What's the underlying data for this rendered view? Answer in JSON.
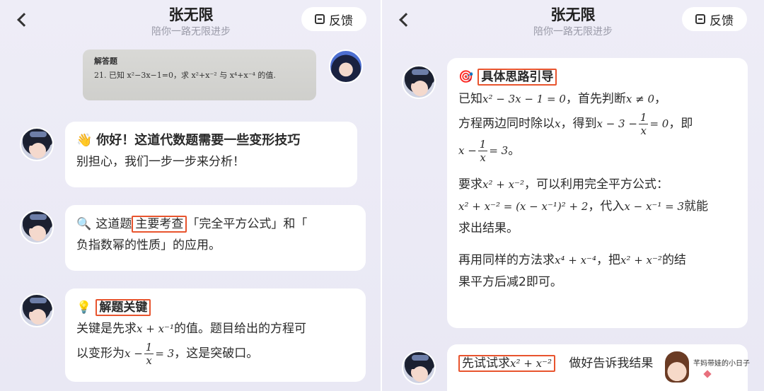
{
  "header": {
    "title": "张无限",
    "subtitle": "陪你一路无限进步",
    "feedback_label": "反馈"
  },
  "left": {
    "photo": {
      "heading": "解答题",
      "question": "21. 已知 x²−3x−1=0，求 x²+x⁻² 与 x⁴+x⁻⁴ 的值."
    },
    "msg1": {
      "emoji": "👋",
      "line1": "你好！这道代数题需要一些变形技巧",
      "line2": "别担心，我们一步一步来分析！"
    },
    "msg2": {
      "emoji": "🔍",
      "pre": "这道题",
      "highlight": "主要考查",
      "post": "「完全平方公式」和「",
      "line2": "负指数幂的性质」的应用。"
    },
    "msg3": {
      "emoji": "💡",
      "heading": "解题关键",
      "l2_pre": "关键是先求",
      "l2_math": "x + x⁻¹",
      "l2_post": "的值。题目给出的方程可",
      "l3_pre": "以变形为",
      "l3_math_a": "x −",
      "frac_num": "1",
      "frac_den": "x",
      "l3_math_b": "= 3",
      "l3_post": "，这是突破口。"
    }
  },
  "right": {
    "msg1": {
      "emoji": "🎯",
      "heading": "具体思路引导",
      "l1_pre": "已知",
      "l1_math": "x² − 3x − 1 = 0",
      "l1_mid": "，首先判断",
      "l1_math2": "x ≠ 0",
      "l1_post": "，",
      "l2_pre": "方程两边同时除以",
      "l2_math": "x",
      "l2_mid": "，得到",
      "l2_math2": "x − 3 −",
      "frac1_num": "1",
      "frac1_den": "x",
      "l2_math3": "= 0",
      "l2_post": "，即",
      "l3_math_a": "x −",
      "frac2_num": "1",
      "frac2_den": "x",
      "l3_math_b": "= 3",
      "l3_post": "。",
      "p2_l1_pre": "要求",
      "p2_l1_math": "x² + x⁻²",
      "p2_l1_post": "，可以利用完全平方公式：",
      "p2_l2_math": "x² + x⁻² = (x − x⁻¹)² + 2",
      "p2_l2_mid": "，代入",
      "p2_l2_math2": "x − x⁻¹ = 3",
      "p2_l2_post": "就能",
      "p2_l3": "求出结果。",
      "p3_l1_pre": "再用同样的方法求",
      "p3_l1_math": "x⁴ + x⁻⁴",
      "p3_l1_mid": "，把",
      "p3_l1_math2": "x² + x⁻²",
      "p3_l1_post": "的结",
      "p3_l2": "果平方后减2即可。"
    },
    "msg2": {
      "highlight_pre": "先试试求",
      "highlight_math": "x² + x⁻²",
      "post": "做好告诉我结果"
    },
    "watermark": "芊妈带娃的小日子"
  }
}
